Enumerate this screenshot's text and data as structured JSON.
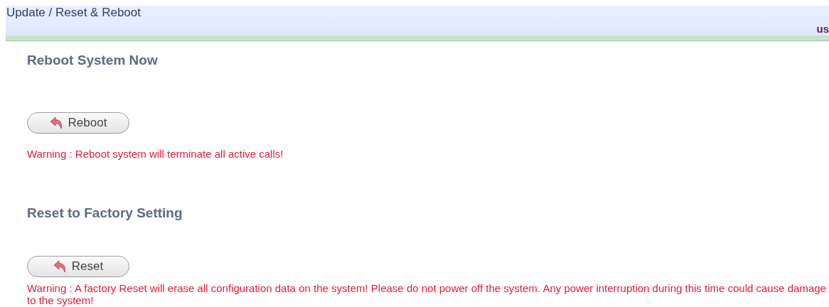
{
  "header": {
    "title": "Update / Reset & Reboot",
    "user": "us"
  },
  "sections": [
    {
      "heading": "Reboot System Now",
      "button": "Reboot",
      "warning": "Warning : Reboot system will terminate all active calls!"
    },
    {
      "heading": "Reset to Factory Setting",
      "button": "Reset",
      "warning": "Warning : A factory Reset will erase all configuration data on the system! Please do not power off the system. Any power interruption during this time could cause damage to the system!"
    }
  ]
}
